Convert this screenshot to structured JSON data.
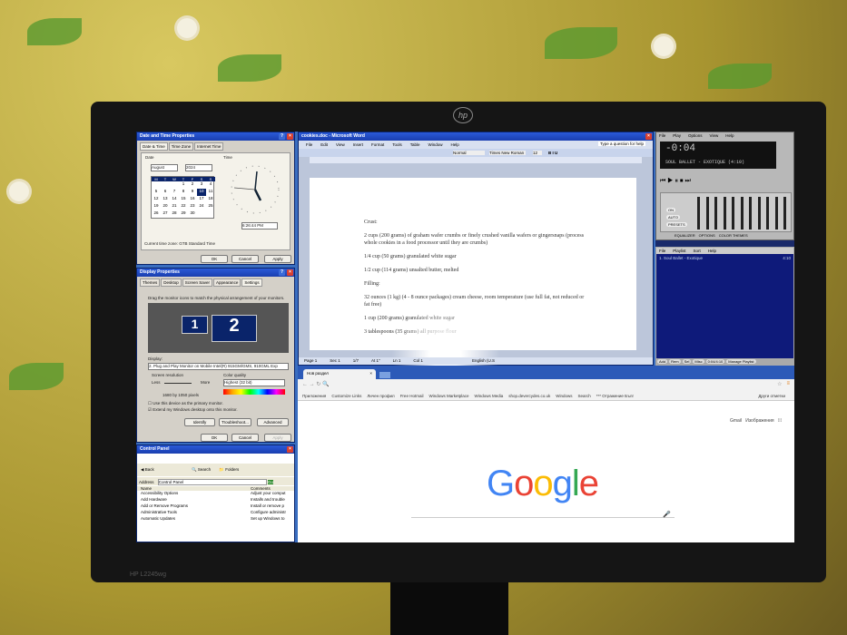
{
  "monitor": {
    "brand": "hp",
    "model": "HP L2245wg"
  },
  "datetime": {
    "title": "Date and Time Properties",
    "tabs": [
      "Date & Time",
      "Time Zone",
      "Internet Time"
    ],
    "date_label": "Date",
    "month": "August",
    "year": "2024",
    "weekdays": [
      "M",
      "T",
      "W",
      "T",
      "F",
      "S",
      "S"
    ],
    "days": [
      "1",
      "2",
      "3",
      "4",
      "5",
      "6",
      "7",
      "8",
      "9",
      "10",
      "11",
      "12",
      "13",
      "14",
      "15",
      "16",
      "17",
      "18",
      "19",
      "20",
      "21",
      "22",
      "23",
      "24",
      "25",
      "26",
      "27",
      "28",
      "29",
      "30"
    ],
    "selected_day": "10",
    "time_label": "Time",
    "time": "6:26:44 PM",
    "timezone": "Current time zone:  GTB Standard Time",
    "ok": "OK",
    "cancel": "Cancel",
    "apply": "Apply"
  },
  "display": {
    "title": "Display Properties",
    "tabs": [
      "Themes",
      "Desktop",
      "Screen Saver",
      "Appearance",
      "Settings"
    ],
    "instruction": "Drag the monitor icons to match the physical arrangement of your monitors.",
    "monitor1": "1",
    "monitor2": "2",
    "display_label": "Display:",
    "display_value": "2. Plug and Play Monitor on Mobile Intel(R) 915GM/GMS, 910GML Exp",
    "resolution_label": "Screen resolution",
    "less": "Less",
    "more": "More",
    "resolution": "1680 by 1050 pixels",
    "color_label": "Color quality",
    "color_value": "Highest (32 bit)",
    "primary": "Use this device as the primary monitor.",
    "extend": "Extend my Windows desktop onto this monitor.",
    "identify": "Identify",
    "troubleshoot": "Troubleshoot...",
    "advanced": "Advanced",
    "ok": "OK",
    "cancel": "Cancel",
    "apply": "Apply"
  },
  "control_panel": {
    "title": "Control Panel",
    "back": "Back",
    "search": "Search",
    "folders": "Folders",
    "address_label": "Address",
    "address": "Control Panel",
    "go": "Go",
    "col_name": "Name",
    "col_comments": "Comments",
    "items": [
      {
        "name": "Accessibility Options",
        "comment": "Adjust your comput"
      },
      {
        "name": "Add Hardware",
        "comment": "Installs and trouble"
      },
      {
        "name": "Add or Remove Programs",
        "comment": "Install or remove p"
      },
      {
        "name": "Administrative Tools",
        "comment": "Configure administr"
      },
      {
        "name": "Automatic Updates",
        "comment": "Set up Windows to"
      }
    ]
  },
  "word": {
    "title": "cookies.doc - Microsoft Word",
    "menu": [
      "File",
      "Edit",
      "View",
      "Insert",
      "Format",
      "Tools",
      "Table",
      "Window",
      "Help"
    ],
    "help_box": "Type a question for help",
    "style": "Normal",
    "font": "Times New Roman",
    "size": "12",
    "paragraphs": [
      "Crust:",
      "2 cups (200 grams) of graham wafer crumbs or finely crushed vanilla wafers or gingersnaps (process whole cookies in a food processor until they are crumbs)",
      "1/4 cup (50 grams) granulated white sugar",
      "1/2 cup (114 grams) unsalted butter, melted",
      "Filling:",
      "32 ounces (1 kg) (4 - 8 ounce packages) cream cheese, room temperature (use full fat, not reduced or fat free)",
      "1 cup (200 grams) granulated white sugar",
      "3 tablespoons (35 grams) all purpose flour"
    ],
    "status": {
      "page": "Page 1",
      "sec": "Sec 1",
      "pages": "1/7",
      "at": "At 1\"",
      "ln": "Ln 1",
      "col": "Col 1",
      "lang": "English (U.S"
    }
  },
  "winamp": {
    "menu": [
      "File",
      "Play",
      "Options",
      "View",
      "Help"
    ],
    "time": "-0:04",
    "track": "SOUL BALLET - EXOTIQUE (4:10)",
    "eq_tabs": [
      "EQUALIZER",
      "OPTIONS",
      "COLOR THEMES"
    ],
    "eq_buttons": [
      "ON",
      "AUTO",
      "PRESETS"
    ],
    "playlist_menu": [
      "File",
      "Playlist",
      "Sort",
      "Help"
    ],
    "playlist": [
      {
        "title": "1. Soul Ballet - Exotique",
        "length": "4:10"
      }
    ],
    "pl_buttons": [
      "Add",
      "Rem",
      "Sel",
      "Misc",
      "0:04/4:10",
      "Manage Playlist"
    ]
  },
  "chrome": {
    "tab": "Нов раздел",
    "bookmarks": [
      "Приложения",
      "Customize Links",
      "Личен профил",
      "Free Hotmail",
      "Windows Marketplace",
      "Windows Media",
      "shop.devercydes.co.uk",
      "Windows",
      "Search",
      "*** Отражение Бълг"
    ],
    "other_bookmarks": "Други отметки",
    "gmail": "Gmail",
    "images": "Изображения",
    "logo": "Google"
  }
}
